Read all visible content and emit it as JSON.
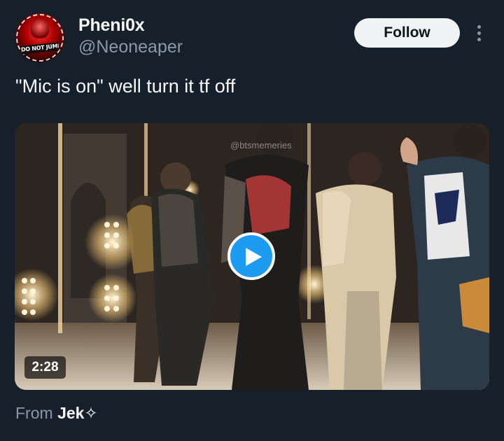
{
  "author": {
    "display_name": "Pheni0x",
    "handle": "@Neoneaper",
    "avatar_badge_text": "DO NOT JUMP",
    "avatar_icon": "profile-avatar-icon"
  },
  "actions": {
    "follow_label": "Follow",
    "more_icon": "more-vertical-icon"
  },
  "tweet": {
    "text": "\"Mic is on\" well turn it tf off"
  },
  "media": {
    "watermark": "@btsmemeries",
    "duration": "2:28",
    "play_icon": "play-icon"
  },
  "attribution": {
    "prefix": "From",
    "source": "Jek✧"
  },
  "colors": {
    "background": "#15202b",
    "text_primary": "#f7f9f9",
    "text_secondary": "#8b98a5",
    "follow_bg": "#eff3f4",
    "play_accent": "#1d9bf0"
  }
}
